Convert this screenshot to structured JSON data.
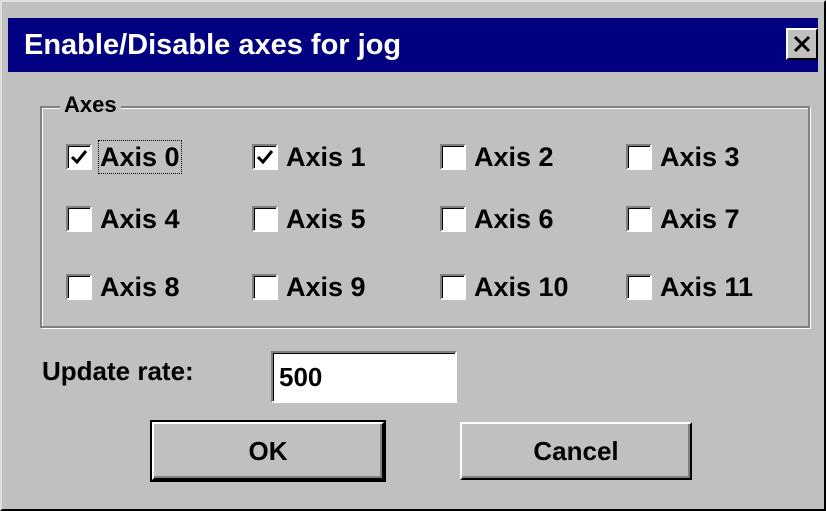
{
  "dialog": {
    "title": "Enable/Disable axes for jog",
    "close_glyph": "✕"
  },
  "axes_group": {
    "label": "Axes",
    "axes": [
      {
        "label": "Axis 0",
        "checked": true
      },
      {
        "label": "Axis 1",
        "checked": true
      },
      {
        "label": "Axis 2",
        "checked": false
      },
      {
        "label": "Axis 3",
        "checked": false
      },
      {
        "label": "Axis 4",
        "checked": false
      },
      {
        "label": "Axis 5",
        "checked": false
      },
      {
        "label": "Axis 6",
        "checked": false
      },
      {
        "label": "Axis 7",
        "checked": false
      },
      {
        "label": "Axis 8",
        "checked": false
      },
      {
        "label": "Axis 9",
        "checked": false
      },
      {
        "label": "Axis 10",
        "checked": false
      },
      {
        "label": "Axis 11",
        "checked": false
      }
    ]
  },
  "update_rate": {
    "label": "Update rate:",
    "value": "500"
  },
  "buttons": {
    "ok": "OK",
    "cancel": "Cancel"
  },
  "colors": {
    "title_bar": "#000080",
    "face": "#c0c0c0"
  }
}
